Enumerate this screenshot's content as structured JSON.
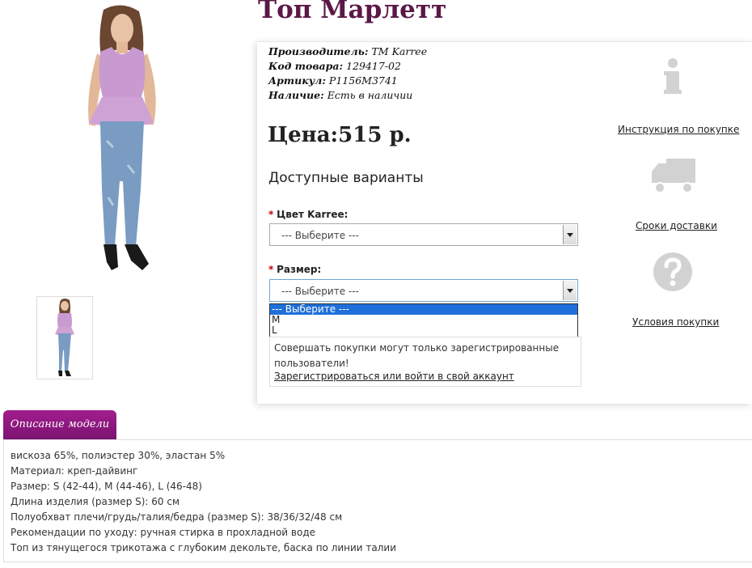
{
  "product": {
    "title": "Топ Марлетт",
    "manufacturer_label": "Производитель:",
    "manufacturer_value": "ТМ Karree",
    "code_label": "Код товара:",
    "code_value": "129417-02",
    "article_label": "Артикул:",
    "article_value": "P1156M3741",
    "stock_label": "Наличие:",
    "stock_value": "Есть в наличии",
    "price": "Цена:515 р."
  },
  "options": {
    "heading": "Доступные варианты",
    "color_label": "Цвет Karree:",
    "color_value": "--- Выберите ---",
    "size_label": "Размер:",
    "size_value": "--- Выберите ---",
    "size_options": [
      "--- Выберите ---",
      "M",
      "L"
    ],
    "required_mark": "*"
  },
  "notice": {
    "text": "Совершать покупки могут только зарегистрированные пользователи!",
    "link": "Зарегистрироваться или войти в свой аккаунт"
  },
  "side": {
    "instruction_link": "Инструкция по покупке",
    "delivery_link": "Сроки доставки",
    "terms_link": "Условия покупки"
  },
  "description": {
    "tab_label": "Описание модели",
    "lines": [
      "вискоза 65%, полиэстер 30%, эластан 5%",
      "Материал: креп-дайвинг",
      "Размер: S (42-44), M (44-46), L (46-48)",
      "Длина изделия (размер S): 60 см",
      "Полуобхват плечи/грудь/талия/бедра (размер S): 38/36/32/48 см",
      "Рекомендации по уходу: ручная стирка в прохладной воде",
      "Топ из тянущегося трикотажа с глубоким декольте, баска по линии талии"
    ]
  },
  "colors": {
    "title": "#5b1846",
    "tab": "#8f1a7f",
    "dropdown_selected": "#1e6fd9",
    "icon_gray": "#d2d2d2"
  }
}
